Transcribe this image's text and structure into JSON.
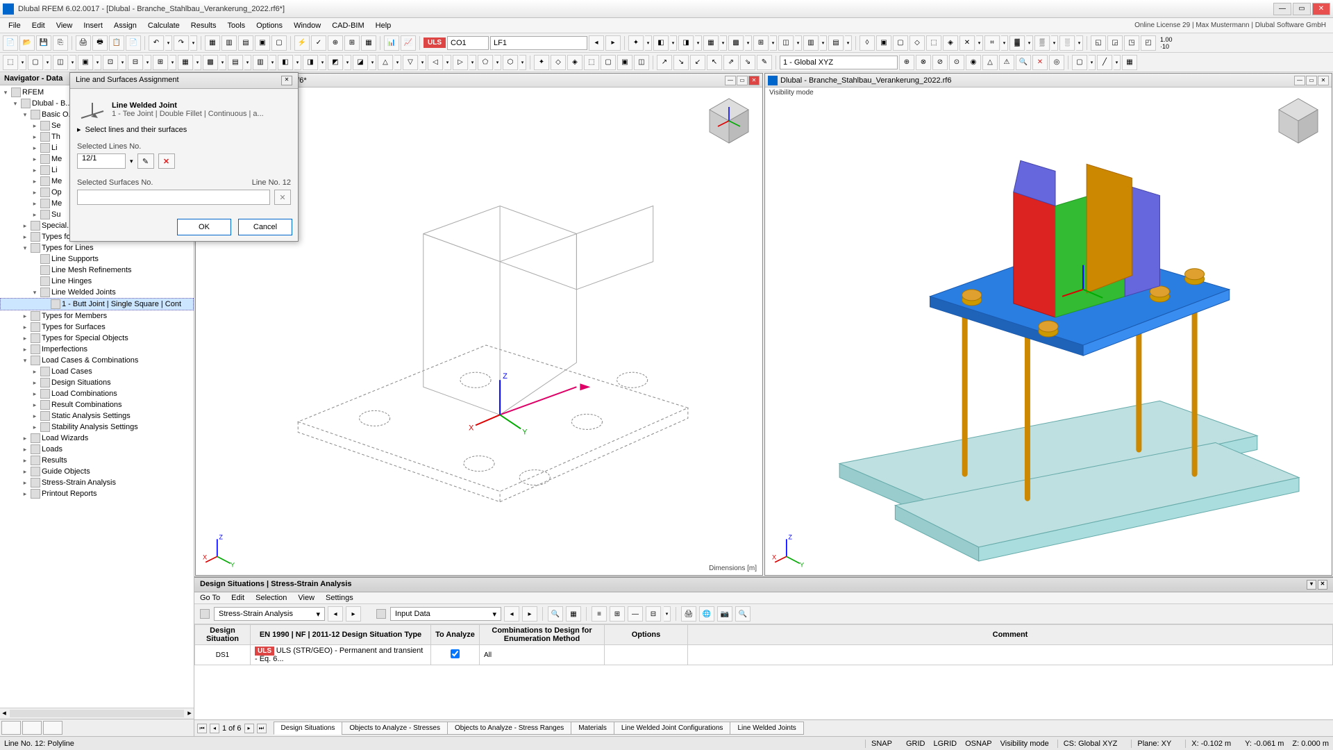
{
  "app": {
    "title": "Dlubal RFEM 6.02.0017 - [Dlubal - Branche_Stahlbau_Verankerung_2022.rf6*]",
    "online": "Online License 29 | Max Mustermann | Dlubal Software GmbH"
  },
  "menus": [
    "File",
    "Edit",
    "View",
    "Insert",
    "Assign",
    "Calculate",
    "Results",
    "Tools",
    "Options",
    "Window",
    "CAD-BIM",
    "Help"
  ],
  "toolbar1": {
    "uls": "ULS",
    "co1": "CO1",
    "lf1": "LF1"
  },
  "toolbar2": {
    "coord": "1 - Global XYZ"
  },
  "navigator": {
    "title": "Navigator - Data",
    "root": "RFEM",
    "project": "Dlubal - B...",
    "items_cut": [
      "Se",
      "Th",
      "Li",
      "Me",
      "Li",
      "Me",
      "Op",
      "Me",
      "Su"
    ],
    "basic_objects": "Basic O...",
    "items2": [
      "Special...",
      "Types for Nodes",
      "Types for Lines",
      "Line Supports",
      "Line Mesh Refinements",
      "Line Hinges",
      "Line Welded Joints",
      "1 - Butt Joint | Single Square | Cont",
      "Types for Members",
      "Types for Surfaces",
      "Types for Special Objects",
      "Imperfections",
      "Load Cases & Combinations",
      "Load Cases",
      "Design Situations",
      "Load Combinations",
      "Result Combinations",
      "Static Analysis Settings",
      "Stability Analysis Settings",
      "Load Wizards",
      "Loads",
      "Results",
      "Guide Objects",
      "Stress-Strain Analysis",
      "Printout Reports"
    ]
  },
  "dialog": {
    "title": "Line and Surfaces Assignment",
    "header": "Line Welded Joint",
    "desc": "1 - Tee Joint | Double Fillet | Continuous | a...",
    "hint": "Select lines and their surfaces",
    "sel_lines_label": "Selected Lines No.",
    "sel_lines_value": "12/1",
    "sel_surf_label": "Selected Surfaces No.",
    "line_no": "Line No. 12",
    "ok": "OK",
    "cancel": "Cancel"
  },
  "viewports": {
    "doc": "bau_Verankerung_2022.rf6*",
    "doc2": "Dlubal - Branche_Stahlbau_Verankerung_2022.rf6",
    "dims": "Dimensions [m]",
    "vismode": "Visibility mode"
  },
  "bottom": {
    "title": "Design Situations | Stress-Strain Analysis",
    "menus": [
      "Go To",
      "Edit",
      "Selection",
      "View",
      "Settings"
    ],
    "combo1": "Stress-Strain Analysis",
    "combo2": "Input Data",
    "pager": "1 of 6",
    "headers": [
      "Design\nSituation",
      "EN 1990 | NF | 2011-12\nDesign Situation Type",
      "To\nAnalyze",
      "Combinations to Design\nfor Enumeration Method",
      "Options",
      "Comment"
    ],
    "row": {
      "ds": "DS1",
      "uls": "ULS",
      "type": "ULS (STR/GEO) - Permanent and transient - Eq. 6...",
      "combi": "All"
    },
    "tabs": [
      "Design Situations",
      "Objects to Analyze - Stresses",
      "Objects to Analyze - Stress Ranges",
      "Materials",
      "Line Welded Joint Configurations",
      "Line Welded Joints"
    ]
  },
  "status": {
    "left": "Line No. 12: Polyline",
    "snap": "SNAP",
    "grid": "GRID",
    "lgrid": "LGRID",
    "osnap": "OSNAP",
    "vis": "Visibility mode",
    "cs": "CS: Global XYZ",
    "plane": "Plane: XY",
    "x": "X: -0.102 m",
    "y": "Y: -0.061 m",
    "z": "Z: 0.000 m"
  }
}
